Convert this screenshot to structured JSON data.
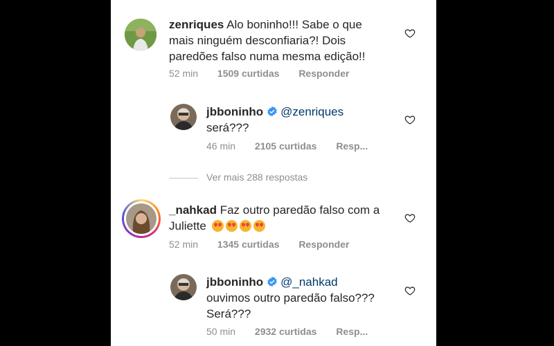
{
  "comments": [
    {
      "username": "zenriques",
      "text_line1": "Alo boninho!!! Sabe o que",
      "text_line2": "mais ninguém desconfiaria?! Dois",
      "text_line3": "paredões falso numa mesma edição!!",
      "time": "52 min",
      "likes": "1509 curtidas",
      "reply": "Responder"
    },
    {
      "username": "jbboninho",
      "mention": "@zenriques",
      "text_line1": "será???",
      "time": "46 min",
      "likes": "2105 curtidas",
      "reply": "Resp..."
    },
    {
      "username": "_nahkad",
      "text_line1": "Faz outro paredão falso com a",
      "text_line2": "Juliette",
      "time": "52 min",
      "likes": "1345 curtidas",
      "reply": "Responder"
    },
    {
      "username": "jbboninho",
      "mention": "@_nahkad",
      "text_line1": "ouvimos outro paredão falso???",
      "text_line2": "Será???",
      "time": "50 min",
      "likes": "2932 curtidas",
      "reply": "Resp..."
    }
  ],
  "view_more": "Ver mais 288 respostas",
  "icons": {
    "heart": "heart-outline-icon",
    "verified": "verified-badge-icon",
    "emoji": "smiling-face-with-hearts-emoji"
  },
  "colors": {
    "verified": "#3897f0",
    "story_ring": "#c13584"
  }
}
